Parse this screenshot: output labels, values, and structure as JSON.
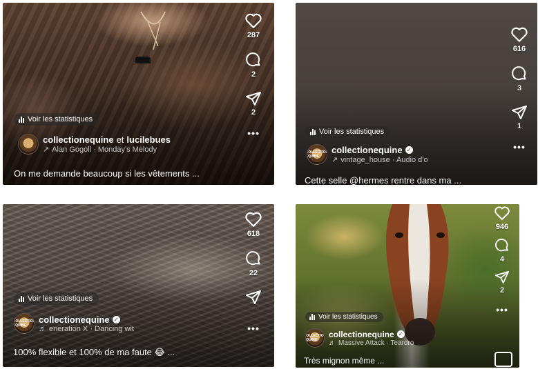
{
  "common": {
    "stats_label": "Voir les statistiques",
    "more": "•••"
  },
  "tiles": [
    {
      "likes": "287",
      "comments": "2",
      "shares": "2",
      "user": "collectionequine",
      "user_joiner": "et",
      "user2": "lucilebues",
      "audio": "Alan Gogoll · Monday's Melody",
      "caption": "On me demande beaucoup si les vêtements ..."
    },
    {
      "likes": "616",
      "comments": "3",
      "shares": "1",
      "user": "collectionequine",
      "audio": "vintage_house · Audio d'o",
      "caption": "Cette selle @hermes rentre dans ma ..."
    },
    {
      "likes": "618",
      "comments": "22",
      "shares": "",
      "user": "collectionequine",
      "audio": "eneration X · Dancing wit",
      "caption": "100% flexible et 100% de ma faute 😂 ..."
    },
    {
      "likes": "946",
      "comments": "4",
      "shares": "2",
      "user": "collectionequine",
      "audio": "Massive Attack · Teardro",
      "caption": "Très mignon même ..."
    }
  ],
  "avatar_text": "COLLECTION EQUINE"
}
